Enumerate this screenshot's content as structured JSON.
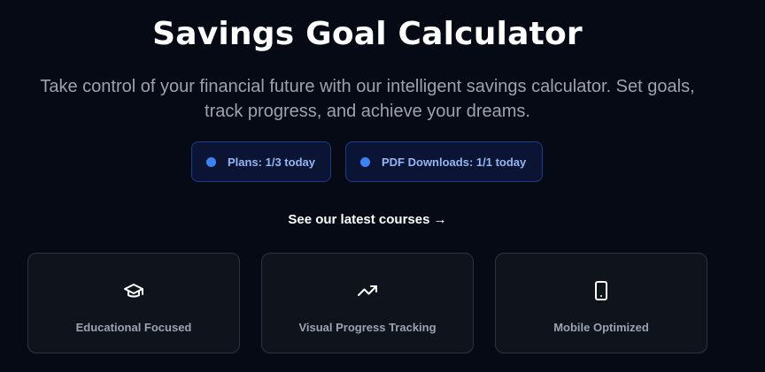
{
  "hero": {
    "title": "Savings Goal Calculator",
    "subtitle": "Take control of your financial future with our intelligent savings calculator. Set goals, track progress, and achieve your dreams."
  },
  "usage_badges": [
    {
      "label": "Plans: 1/3 today",
      "icon": "status-dot"
    },
    {
      "label": "PDF Downloads: 1/1 today",
      "icon": "status-dot"
    }
  ],
  "courses_link": {
    "label": "See our latest courses →"
  },
  "features": [
    {
      "label": "Educational Focused",
      "icon": "graduation-cap-icon"
    },
    {
      "label": "Visual Progress Tracking",
      "icon": "trending-up-icon"
    },
    {
      "label": "Mobile Optimized",
      "icon": "smartphone-icon"
    }
  ],
  "colors": {
    "background": "#050a14",
    "accent": "#3b82f6",
    "badge_text": "#93b4f5",
    "muted_text": "#9ca3af"
  }
}
